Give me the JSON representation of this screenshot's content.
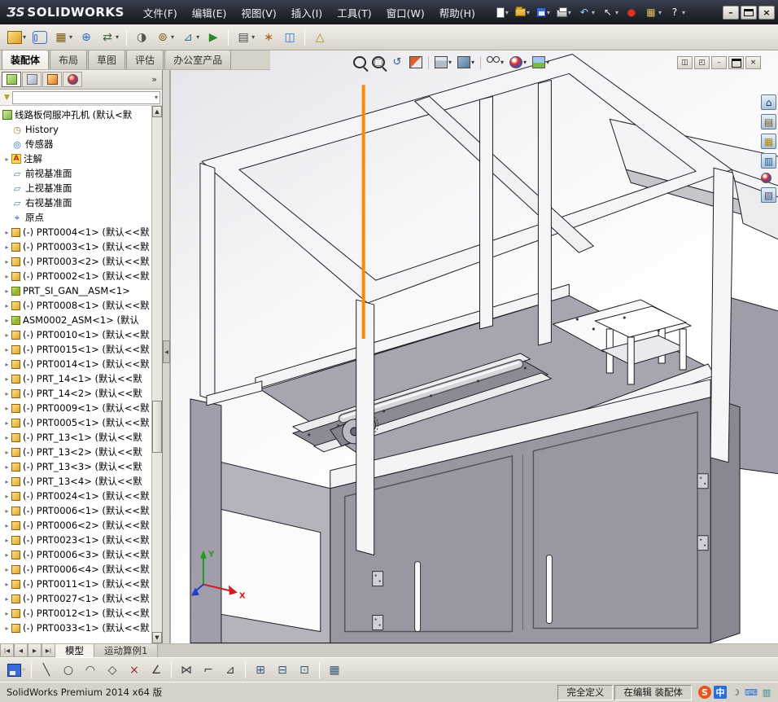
{
  "ui": {
    "dropdown_glyph": "▾",
    "expand_glyph": "▸",
    "scroll_up_glyph": "▲",
    "scroll_down_glyph": "▼",
    "collapse_glyph": "◀",
    "funnel_glyph": "▼"
  },
  "titlebar": {
    "logo_mark": "ƷS",
    "logo_text": "SOLIDWORKS",
    "menus": [
      {
        "name": "menu-file",
        "label": "文件(F)"
      },
      {
        "name": "menu-edit",
        "label": "编辑(E)"
      },
      {
        "name": "menu-view",
        "label": "视图(V)"
      },
      {
        "name": "menu-insert",
        "label": "插入(I)"
      },
      {
        "name": "menu-tools",
        "label": "工具(T)"
      },
      {
        "name": "menu-window",
        "label": "窗口(W)"
      },
      {
        "name": "menu-help",
        "label": "帮助(H)"
      }
    ],
    "icons": [
      {
        "name": "new-document-icon",
        "cls": "ic-page",
        "dropdown": true
      },
      {
        "name": "open-icon",
        "cls": "ic-folder",
        "dropdown": true
      },
      {
        "name": "save-icon",
        "cls": "ic-floppy",
        "dropdown": true
      },
      {
        "name": "print-icon",
        "cls": "ic-print",
        "dropdown": true
      },
      {
        "name": "undo-icon",
        "glyph": "↶",
        "color": "#9ecbff",
        "dropdown": true
      },
      {
        "name": "select-arrow-icon",
        "glyph": "↖",
        "color": "#f4f4f8",
        "dropdown": true
      },
      {
        "name": "record-macro-icon",
        "glyph": "●",
        "color": "#e03020"
      },
      {
        "name": "options-icon",
        "glyph": "▦",
        "color": "#e0c060",
        "dropdown": true
      },
      {
        "name": "help-icon",
        "glyph": "?",
        "color": "#ffffff",
        "dropdown": true
      }
    ],
    "window_buttons": [
      {
        "name": "minimize-button",
        "glyph": "–"
      },
      {
        "name": "maximize-button",
        "cls": "ic-max"
      },
      {
        "name": "close-button",
        "glyph": "×"
      }
    ]
  },
  "toolbar": {
    "icons": [
      {
        "name": "insert-component-icon",
        "cls": "ic-cube-gold",
        "dropdown": true
      },
      {
        "name": "mate-icon",
        "cls": "ic-clip"
      },
      {
        "name": "linear-component-pattern-icon",
        "glyph": "▦",
        "color": "#7a5a10",
        "dropdown": true
      },
      {
        "name": "smart-fasteners-icon",
        "glyph": "⊕",
        "color": "#2a6fd6"
      },
      {
        "name": "move-component-icon",
        "glyph": "⇄",
        "color": "#3a6a3a",
        "dropdown": true
      },
      {
        "sep": true
      },
      {
        "name": "show-hidden-components-icon",
        "glyph": "◑",
        "color": "#555555"
      },
      {
        "name": "assembly-features-icon",
        "glyph": "⊚",
        "color": "#7a5a10",
        "dropdown": true
      },
      {
        "name": "reference-geometry-icon",
        "glyph": "⊿",
        "color": "#3a7a9a",
        "dropdown": true
      },
      {
        "name": "new-motion-study-icon",
        "glyph": "▶",
        "color": "#2a8a2a"
      },
      {
        "sep": true
      },
      {
        "name": "bill-of-materials-icon",
        "glyph": "▤",
        "color": "#4a4a4a",
        "dropdown": true
      },
      {
        "name": "exploded-view-icon",
        "glyph": "∗",
        "color": "#b05a10"
      },
      {
        "name": "interference-detection-icon",
        "glyph": "◫",
        "color": "#2a6fd6"
      },
      {
        "sep": true
      },
      {
        "name": "instant3d-icon",
        "glyph": "△",
        "color": "#b08a10"
      }
    ]
  },
  "command_tabs": {
    "active_index": 0,
    "items": [
      {
        "name": "tab-assembly",
        "label": "装配体"
      },
      {
        "name": "tab-layout",
        "label": "布局"
      },
      {
        "name": "tab-sketch",
        "label": "草图"
      },
      {
        "name": "tab-evaluate",
        "label": "评估"
      },
      {
        "name": "tab-office-products",
        "label": "办公室产品"
      }
    ]
  },
  "hud": {
    "icons": [
      {
        "name": "zoom-fit-icon",
        "cls": "ic-mag"
      },
      {
        "name": "zoom-area-icon",
        "cls": "ic-magrect"
      },
      {
        "name": "previous-view-icon",
        "glyph": "↺",
        "color": "#2a5a9a"
      },
      {
        "name": "section-view-icon",
        "cls": "ic-section"
      },
      {
        "sep": true
      },
      {
        "name": "view-orientation-icon",
        "cls": "ic-cube",
        "dropdown": true
      },
      {
        "name": "display-style-icon",
        "cls": "ic-cube2",
        "dropdown": true
      },
      {
        "sep": true
      },
      {
        "name": "hide-show-items-icon",
        "cls": "ic-glasses",
        "dropdown": true
      },
      {
        "name": "edit-appearance-icon",
        "cls": "ic-ball",
        "dropdown": true
      },
      {
        "name": "apply-scene-icon",
        "cls": "ic-scene",
        "dropdown": true
      }
    ]
  },
  "doc_window_buttons": [
    {
      "name": "doc-new-window-icon",
      "glyph": "◫"
    },
    {
      "name": "doc-split-icon",
      "glyph": "◰"
    },
    {
      "name": "doc-minimize-button",
      "glyph": "–"
    },
    {
      "name": "doc-restore-button",
      "cls": "ic-max"
    },
    {
      "name": "doc-close-button",
      "glyph": "×"
    }
  ],
  "taskpane": {
    "icons": [
      {
        "name": "resources-icon",
        "cls": "tp-box",
        "glyph": "⌂",
        "color": "#1a3a5a"
      },
      {
        "name": "design-library-icon",
        "cls": "tp-box",
        "glyph": "▤",
        "color": "#7a5a10"
      },
      {
        "name": "file-explorer-icon",
        "cls": "tp-box",
        "glyph": "▦",
        "color": "#b8860b"
      },
      {
        "name": "view-palette-icon",
        "cls": "tp-box",
        "glyph": "▥",
        "color": "#2a5a8a"
      },
      {
        "name": "appearances-icon",
        "cls": "ic-ball"
      },
      {
        "name": "custom-properties-icon",
        "cls": "tp-box",
        "glyph": "▧",
        "color": "#4a4a6a"
      }
    ]
  },
  "feature_tree": {
    "panel_tabs": [
      {
        "name": "featuremanager-tab",
        "cls": "pt-feature"
      },
      {
        "name": "propertymanager-tab",
        "cls": "pt-property"
      },
      {
        "name": "configurationmanager-tab",
        "cls": "pt-config"
      },
      {
        "name": "displaymanager-tab",
        "cls": "pt-display"
      }
    ],
    "overflow": "»",
    "root": {
      "label": "线路板伺服冲孔机 (默认<默"
    },
    "icon_glyphs": {
      "history": "◷",
      "sensors": "◎",
      "annotations": "A",
      "plane": "▱",
      "origin": "⌖",
      "part": "",
      "asm": ""
    },
    "items": [
      {
        "icon": "history",
        "label": "History"
      },
      {
        "icon": "sensors",
        "label": "传感器"
      },
      {
        "icon": "annotations",
        "label": "注解",
        "arrow": true
      },
      {
        "icon": "plane",
        "label": "前视基准面"
      },
      {
        "icon": "plane",
        "label": "上视基准面"
      },
      {
        "icon": "plane",
        "label": "右视基准面"
      },
      {
        "icon": "origin",
        "label": "原点"
      },
      {
        "icon": "part",
        "arrow": true,
        "label": "(-) PRT0004<1> (默认<<默"
      },
      {
        "icon": "part",
        "arrow": true,
        "label": "(-) PRT0003<1> (默认<<默"
      },
      {
        "icon": "part",
        "arrow": true,
        "label": "(-) PRT0003<2> (默认<<默"
      },
      {
        "icon": "part",
        "arrow": true,
        "label": "(-) PRT0002<1> (默认<<默"
      },
      {
        "icon": "asm",
        "arrow": true,
        "label": "PRT_SI_GAN__ASM<1>"
      },
      {
        "icon": "part",
        "arrow": true,
        "label": "(-) PRT0008<1> (默认<<默"
      },
      {
        "icon": "asm",
        "arrow": true,
        "label": "ASM0002_ASM<1> (默认"
      },
      {
        "icon": "part",
        "arrow": true,
        "label": "(-) PRT0010<1> (默认<<默"
      },
      {
        "icon": "part",
        "arrow": true,
        "label": "(-) PRT0015<1> (默认<<默"
      },
      {
        "icon": "part",
        "arrow": true,
        "label": "(-) PRT0014<1> (默认<<默"
      },
      {
        "icon": "part",
        "arrow": true,
        "label": "(-) PRT_14<1> (默认<<默"
      },
      {
        "icon": "part",
        "arrow": true,
        "label": "(-) PRT_14<2> (默认<<默"
      },
      {
        "icon": "part",
        "arrow": true,
        "label": "(-) PRT0009<1> (默认<<默"
      },
      {
        "icon": "part",
        "arrow": true,
        "label": "(-) PRT0005<1> (默认<<默"
      },
      {
        "icon": "part",
        "arrow": true,
        "label": "(-) PRT_13<1> (默认<<默"
      },
      {
        "icon": "part",
        "arrow": true,
        "label": "(-) PRT_13<2> (默认<<默"
      },
      {
        "icon": "part",
        "arrow": true,
        "label": "(-) PRT_13<3> (默认<<默"
      },
      {
        "icon": "part",
        "arrow": true,
        "label": "(-) PRT_13<4> (默认<<默"
      },
      {
        "icon": "part",
        "arrow": true,
        "label": "(-) PRT0024<1> (默认<<默"
      },
      {
        "icon": "part",
        "arrow": true,
        "label": "(-) PRT0006<1> (默认<<默"
      },
      {
        "icon": "part",
        "arrow": true,
        "label": "(-) PRT0006<2> (默认<<默"
      },
      {
        "icon": "part",
        "arrow": true,
        "label": "(-) PRT0023<1> (默认<<默"
      },
      {
        "icon": "part",
        "arrow": true,
        "label": "(-) PRT0006<3> (默认<<默"
      },
      {
        "icon": "part",
        "arrow": true,
        "label": "(-) PRT0006<4> (默认<<默"
      },
      {
        "icon": "part",
        "arrow": true,
        "label": "(-) PRT0011<1> (默认<<默"
      },
      {
        "icon": "part",
        "arrow": true,
        "label": "(-) PRT0027<1> (默认<<默"
      },
      {
        "icon": "part",
        "arrow": true,
        "label": "(-) PRT0012<1> (默认<<默"
      },
      {
        "icon": "part",
        "arrow": true,
        "label": "(-) PRT0033<1> (默认<<默"
      }
    ]
  },
  "viewport": {
    "highlight_color": "#ff8a00",
    "triad": {
      "x": "X",
      "y": "Y"
    }
  },
  "bottom_tabs": {
    "nav": [
      {
        "name": "first-tab-button",
        "glyph": "|◀"
      },
      {
        "name": "prev-tab-button",
        "glyph": "◀"
      },
      {
        "name": "next-tab-button",
        "glyph": "▶"
      },
      {
        "name": "last-tab-button",
        "glyph": "▶|"
      }
    ],
    "tabs": [
      {
        "name": "tab-model",
        "label": "模型",
        "active": true
      },
      {
        "name": "tab-motion-study-1",
        "label": "运动算例1",
        "active": false
      }
    ]
  },
  "sketchbar": {
    "icons": [
      {
        "name": "sketch-save-icon",
        "cls": "ic-floppy",
        "dropdown": true
      },
      {
        "sep": true
      },
      {
        "name": "line-icon",
        "glyph": "╲",
        "color": "#3a3a44"
      },
      {
        "name": "circle-icon",
        "glyph": "○",
        "color": "#3a3a44"
      },
      {
        "name": "arc-icon",
        "glyph": "◠",
        "color": "#3a3a44"
      },
      {
        "name": "polygon-icon",
        "glyph": "◇",
        "color": "#3a3a44"
      },
      {
        "name": "trim-icon",
        "glyph": "×",
        "color": "#8a2a2a"
      },
      {
        "name": "angle-icon",
        "glyph": "∠",
        "color": "#3a3a44"
      },
      {
        "sep": true
      },
      {
        "name": "mirror-icon",
        "glyph": "⋈",
        "color": "#3a3a44"
      },
      {
        "name": "offset-icon",
        "glyph": "⌐",
        "color": "#3a3a44"
      },
      {
        "name": "convert-entities-icon",
        "glyph": "⊿",
        "color": "#3a3a44"
      },
      {
        "sep": true
      },
      {
        "name": "grid-icon",
        "glyph": "⊞",
        "color": "#3a5a7a"
      },
      {
        "name": "snap-icon",
        "glyph": "⊟",
        "color": "#3a5a7a"
      },
      {
        "name": "plane-icon",
        "glyph": "⊡",
        "color": "#3a5a7a"
      },
      {
        "sep": true
      },
      {
        "name": "evaluate-icon",
        "glyph": "▦",
        "color": "#3a5a7a"
      }
    ]
  },
  "statusbar": {
    "app": "SolidWorks Premium 2014 x64 版",
    "define_state": "完全定义",
    "edit_state": "在编辑 装配体",
    "tray": [
      {
        "name": "sogou-icon",
        "glyph": "S",
        "color": "#ffffff",
        "bg": "#e8541e",
        "round": true
      },
      {
        "name": "ime-chinese-icon",
        "glyph": "中",
        "color": "#ffffff",
        "bg": "#2a6fd6"
      },
      {
        "name": "ime-mode-icon",
        "glyph": "☽",
        "color": "#333333"
      },
      {
        "name": "keyboard-icon",
        "glyph": "⌨",
        "color": "#2a6fd6"
      },
      {
        "name": "network-icon",
        "glyph": "▥",
        "color": "#2a8a8a"
      }
    ]
  }
}
